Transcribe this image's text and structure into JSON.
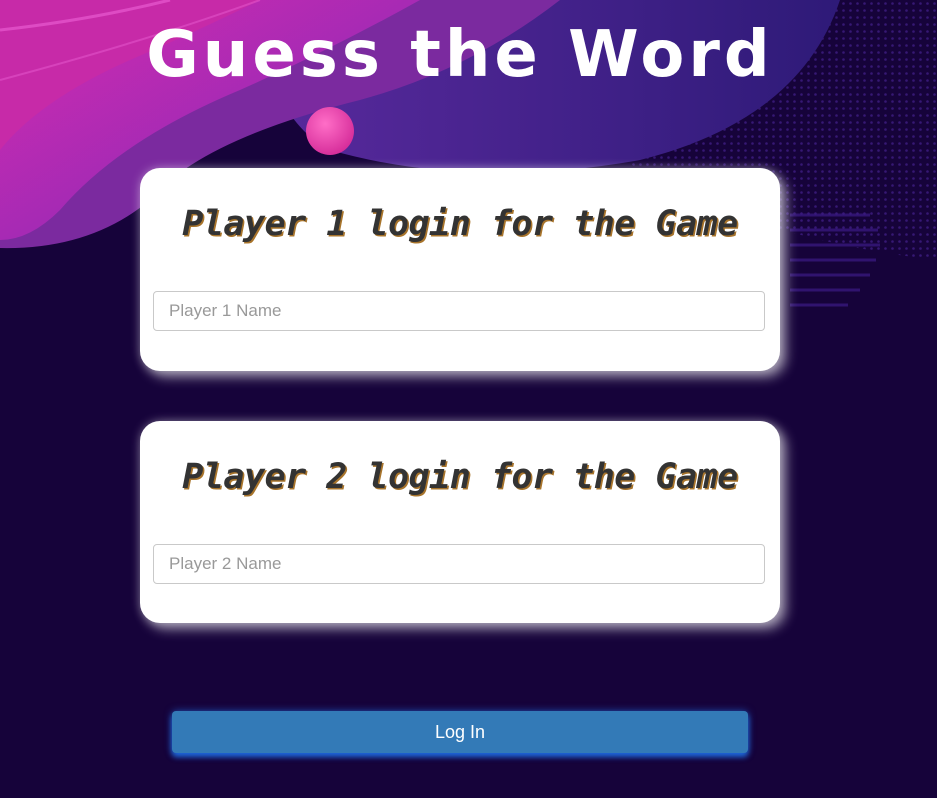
{
  "header": {
    "title": "Guess the Word"
  },
  "players": [
    {
      "heading": "Player 1 login for the Game",
      "input_placeholder": "Player 1 Name",
      "input_value": ""
    },
    {
      "heading": "Player 2 login for the Game",
      "input_placeholder": "Player 2 Name",
      "input_value": ""
    }
  ],
  "actions": {
    "login_label": "Log In"
  },
  "colors": {
    "background": "#16033a",
    "accent_magenta": "#c42aa6",
    "button": "#337ab7",
    "card": "#ffffff"
  }
}
